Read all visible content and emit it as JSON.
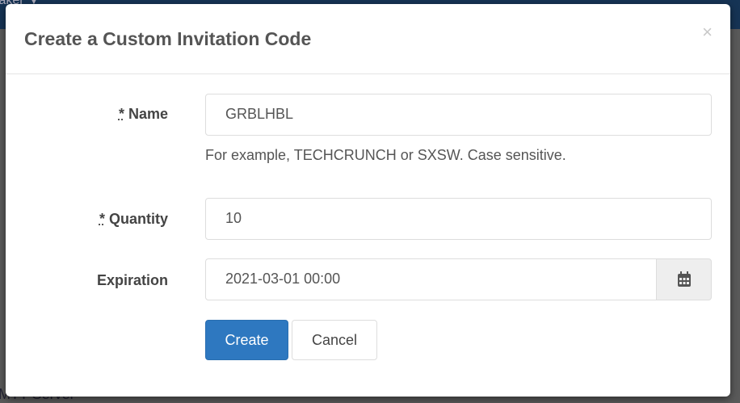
{
  "background": {
    "nav_text": "taker ▼",
    "sidebar_text": "MTT Server"
  },
  "modal": {
    "title": "Create a Custom Invitation Code",
    "close_label": "×",
    "fields": {
      "name": {
        "required_mark": "*",
        "label": "Name",
        "value": "GRBLHBL",
        "help": "For example, TECHCRUNCH or SXSW. Case sensitive."
      },
      "quantity": {
        "required_mark": "*",
        "label": "Quantity",
        "value": "10"
      },
      "expiration": {
        "label": "Expiration",
        "value": "2021-03-01 00:00",
        "icon": "calendar-icon"
      }
    },
    "buttons": {
      "create": "Create",
      "cancel": "Cancel"
    }
  },
  "colors": {
    "primary": "#2e78c0"
  }
}
